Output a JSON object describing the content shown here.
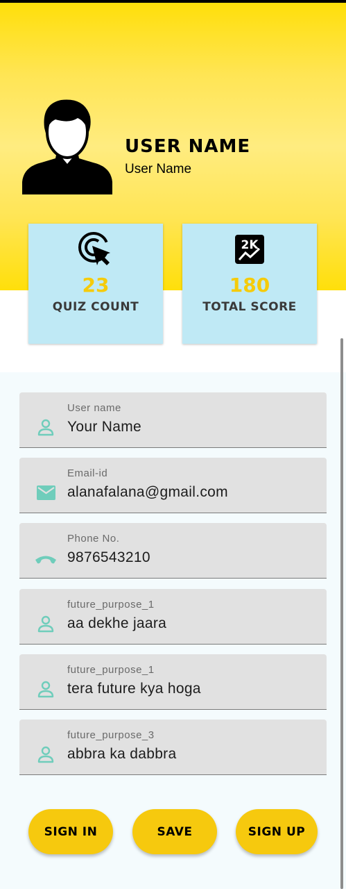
{
  "profile": {
    "title": "USER NAME",
    "subtitle": "User Name",
    "avatar_icon": "person-silhouette-icon"
  },
  "stats": [
    {
      "icon": "cursor-click-icon",
      "value": "23",
      "label": "QUIZ COUNT"
    },
    {
      "icon": "score-chart-icon",
      "icon_text": "2K",
      "value": "180",
      "label": "TOTAL SCORE"
    }
  ],
  "form": {
    "fields": [
      {
        "label": "User name",
        "value": "Your Name",
        "icon": "person-icon"
      },
      {
        "label": "Email-id",
        "value": "alanafalana@gmail.com",
        "icon": "email-icon"
      },
      {
        "label": "Phone No.",
        "value": "9876543210",
        "icon": "phone-icon"
      },
      {
        "label": "future_purpose_1",
        "value": "aa dekhe jaara",
        "icon": "person-icon"
      },
      {
        "label": "future_purpose_1",
        "value": "tera future kya hoga",
        "icon": "person-icon"
      },
      {
        "label": "future_purpose_3",
        "value": "abbra ka dabbra",
        "icon": "person-icon"
      }
    ]
  },
  "buttons": {
    "signin": "SIGN IN",
    "save": "SAVE",
    "signup": "SIGN UP"
  },
  "colors": {
    "header_yellow": "#ffdf0a",
    "stat_card_bg": "#bfe9f5",
    "accent_yellow": "#f6c90e",
    "icon_teal": "#6fcdbb",
    "field_bg": "#e1e1e1"
  }
}
